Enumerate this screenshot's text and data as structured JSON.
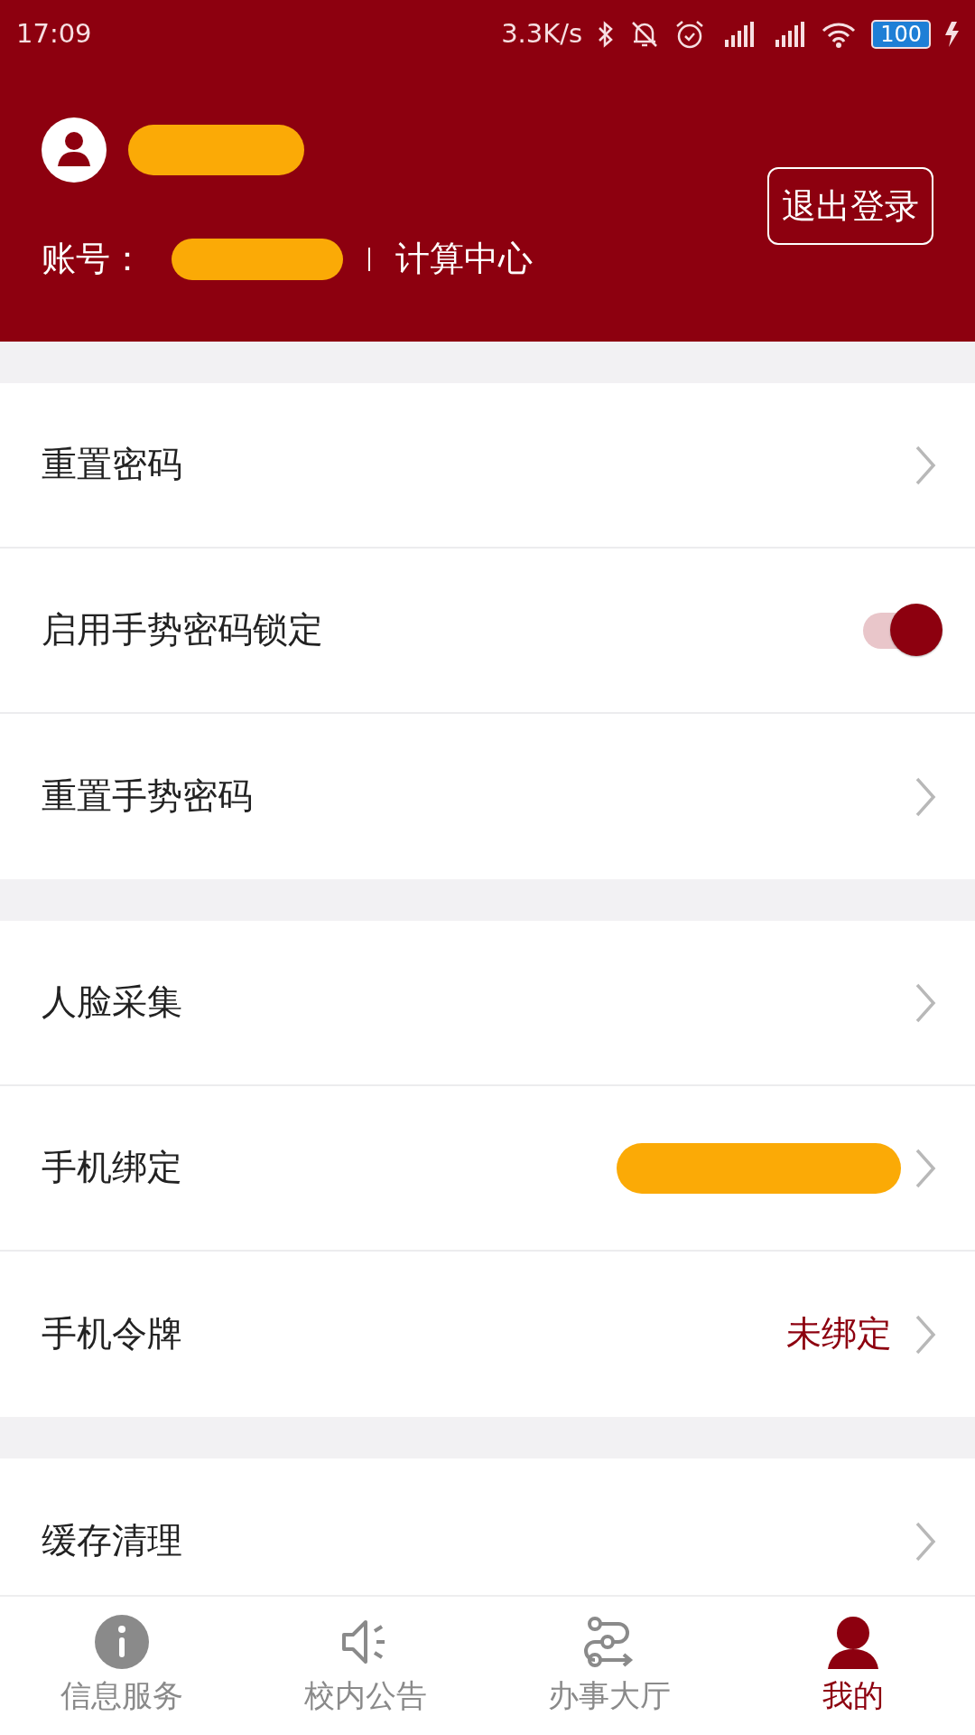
{
  "status_bar": {
    "time": "17:09",
    "speed": "3.3K/s",
    "battery": "100"
  },
  "header": {
    "name_redacted": true,
    "account_label": "账号：",
    "account_redacted": true,
    "department": "计算中心",
    "logout_button": "退出登录"
  },
  "sections": [
    {
      "items": [
        {
          "kind": "link",
          "label": "重置密码"
        },
        {
          "kind": "toggle",
          "label": "启用手势密码锁定",
          "on": true
        },
        {
          "kind": "link",
          "label": "重置手势密码"
        }
      ]
    },
    {
      "items": [
        {
          "kind": "link",
          "label": "人脸采集"
        },
        {
          "kind": "link",
          "label": "手机绑定",
          "value_redacted": true
        },
        {
          "kind": "link",
          "label": "手机令牌",
          "value": "未绑定"
        }
      ]
    },
    {
      "items": [
        {
          "kind": "link",
          "label": "缓存清理"
        }
      ]
    }
  ],
  "bottom_nav": [
    {
      "label": "信息服务",
      "selected": false
    },
    {
      "label": "校内公告",
      "selected": false
    },
    {
      "label": "办事大厅",
      "selected": false
    },
    {
      "label": "我的",
      "selected": true
    }
  ]
}
